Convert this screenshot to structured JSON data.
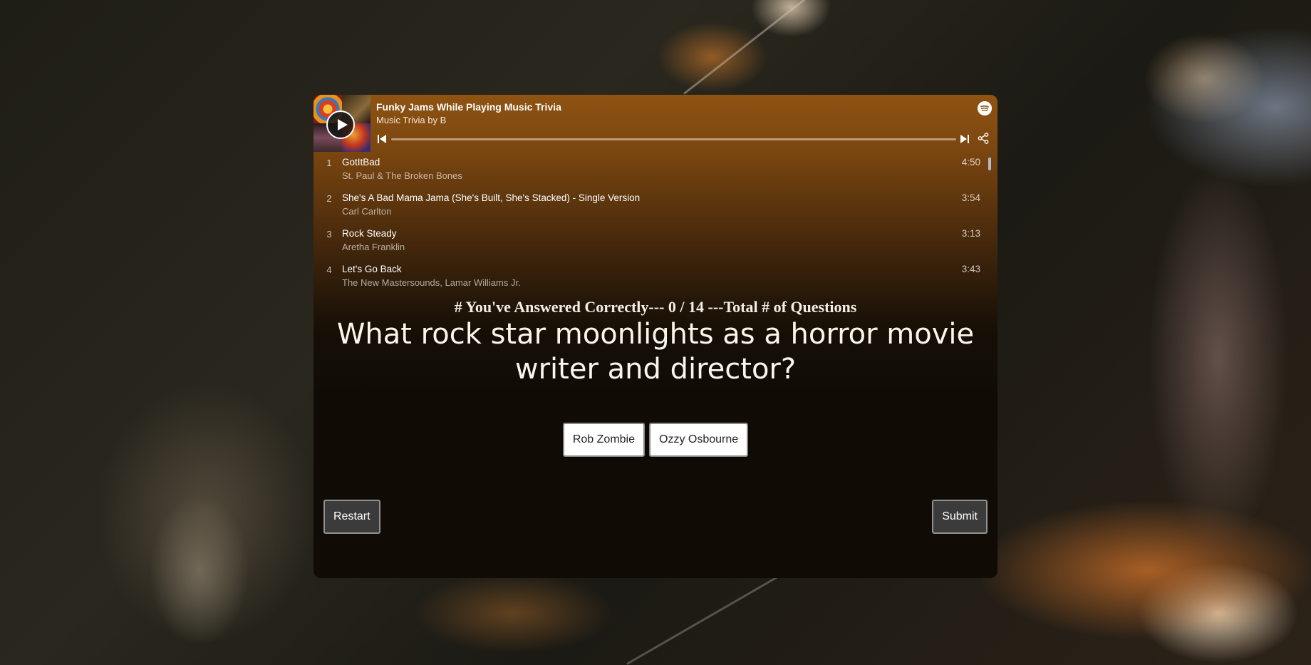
{
  "player": {
    "playlist_title": "Funky Jams While Playing Music Trivia",
    "playlist_subtitle": "Music Trivia by B",
    "tracks": [
      {
        "num": "1",
        "name": "GotItBad",
        "artist": "St. Paul & The Broken Bones",
        "duration": "4:50"
      },
      {
        "num": "2",
        "name": "She's A Bad Mama Jama (She's Built, She's Stacked) - Single Version",
        "artist": "Carl Carlton",
        "duration": "3:54"
      },
      {
        "num": "3",
        "name": "Rock Steady",
        "artist": "Aretha Franklin",
        "duration": "3:13"
      },
      {
        "num": "4",
        "name": "Let's Go Back",
        "artist": "The New Mastersounds, Lamar Williams Jr.",
        "duration": "3:43"
      }
    ],
    "icons": [
      "play-icon",
      "spotify-icon",
      "previous-track-icon",
      "next-track-icon",
      "share-icon"
    ]
  },
  "quiz": {
    "score_text": "# You've Answered Correctly--- 0 / 14 ---Total # of Questions",
    "question": "What rock star moonlights as a horror movie writer and director?",
    "answers": [
      "Rob Zombie",
      "Ozzy Osbourne"
    ],
    "restart_label": "Restart",
    "submit_label": "Submit"
  },
  "colors": {
    "player_header": "#8f5312",
    "card_bottom": "#100c05",
    "button_dark": "#3b3b3b"
  }
}
